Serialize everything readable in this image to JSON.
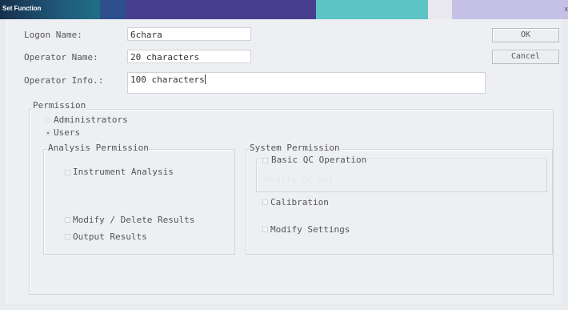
{
  "window": {
    "title": "Set Function",
    "close_glyph": "x"
  },
  "form": {
    "logon_label": "Logon Name:",
    "logon_value": "6chara",
    "operator_name_label": "Operator Name:",
    "operator_name_value": "20 characters",
    "operator_info_label": "Operator Info.:",
    "operator_info_value": "100 characters"
  },
  "buttons": {
    "ok": "OK",
    "cancel": "Cancel"
  },
  "permission": {
    "title": "Permission",
    "options": [
      "Administrators",
      "Users"
    ],
    "selected": "Users"
  },
  "analysis": {
    "title": "Analysis Permission",
    "items": [
      "Instrument Analysis",
      "Modify / Delete Results",
      "Output Results"
    ]
  },
  "system": {
    "title": "System Permission",
    "basic_qc": "Basic QC Operation",
    "modify_qc": "Modify QC Set",
    "calibration": "Calibration",
    "modify_settings": "Modify Settings"
  }
}
